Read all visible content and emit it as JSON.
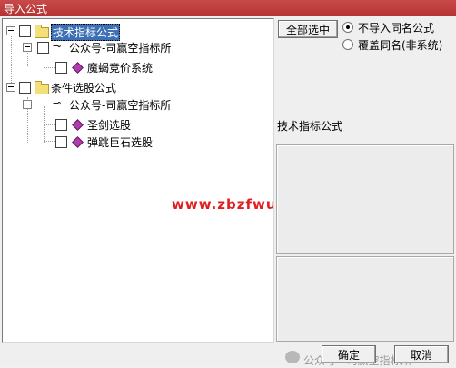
{
  "window": {
    "title": "导入公式"
  },
  "tree": {
    "nodes": [
      {
        "label": "技术指标公式",
        "level": 0,
        "type": "folder",
        "selected": true
      },
      {
        "label": "公众号-司赢空指标所",
        "level": 1,
        "type": "key"
      },
      {
        "label": "魔蝎竞价系统",
        "level": 2,
        "type": "formula"
      },
      {
        "label": "条件选股公式",
        "level": 0,
        "type": "folder"
      },
      {
        "label": "公众号-司赢空指标所",
        "level": 1,
        "type": "key"
      },
      {
        "label": "圣剑选股",
        "level": 2,
        "type": "formula"
      },
      {
        "label": "弹跳巨石选股",
        "level": 2,
        "type": "formula"
      }
    ]
  },
  "options": {
    "select_all_label": "全部选中",
    "radio_no_import": "不导入同名公式",
    "radio_overwrite": "覆盖同名(非系统)",
    "selected": "不导入同名公式"
  },
  "info": {
    "label": "技术指标公式"
  },
  "buttons": {
    "ok": "确定",
    "cancel": "取消"
  },
  "watermarks": {
    "site": "www.zbzfwu.com",
    "wechat": "公众号 · 司赢空指标所"
  },
  "colors": {
    "title_bar": "#b53232",
    "selection": "#3d6fb5",
    "watermark": "#e02020",
    "formula_icon": "#b03cb0"
  }
}
